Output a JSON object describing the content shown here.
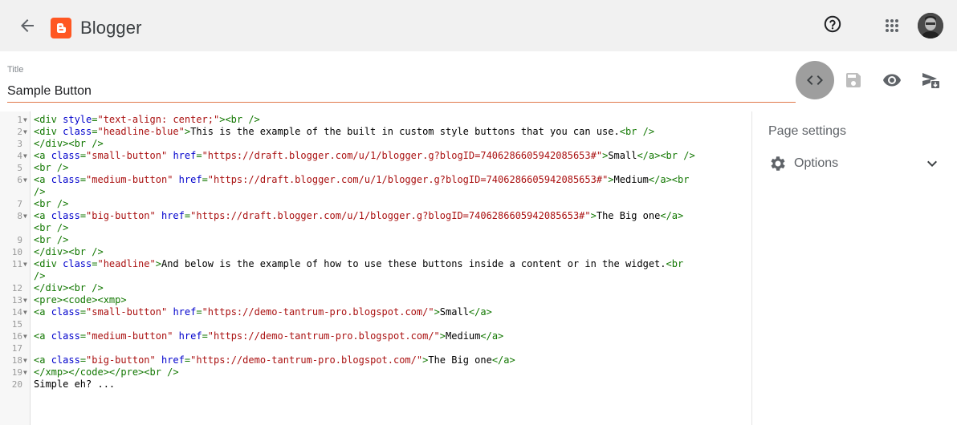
{
  "app": {
    "brand": "Blogger"
  },
  "icons": {
    "back": "arrow-back-icon",
    "logo": "blogger-logo-icon",
    "help": "help-icon",
    "apps": "apps-grid-icon",
    "avatar": "account-avatar",
    "html_view": "code-icon",
    "save": "save-icon",
    "preview": "eye-icon",
    "publish": "send-icon",
    "gear": "gear-icon",
    "chevron": "chevron-down-icon"
  },
  "colors": {
    "brand_orange": "#ff5722",
    "title_underline": "#e0794a",
    "html_view_bg": "#9e9e9e"
  },
  "title": {
    "label": "Title",
    "value": "Sample Button"
  },
  "sidebar": {
    "heading": "Page settings",
    "options_label": "Options"
  },
  "editor": {
    "lines": [
      {
        "n": "1",
        "fold": "▼",
        "y": 0,
        "parts": [
          [
            "t",
            "<div "
          ],
          [
            "a",
            "style"
          ],
          [
            "t",
            "="
          ],
          [
            "s",
            "\"text-align: center;\""
          ],
          [
            "t",
            ">"
          ],
          [
            "t",
            "<br />"
          ]
        ]
      },
      {
        "n": "2",
        "fold": "▼",
        "y": 1,
        "parts": [
          [
            "t",
            "<div "
          ],
          [
            "a",
            "class"
          ],
          [
            "t",
            "="
          ],
          [
            "s",
            "\"headline-blue\""
          ],
          [
            "t",
            ">"
          ],
          [
            "x",
            "This is the example of the built in custom style buttons that you can use."
          ],
          [
            "t",
            "<br />"
          ]
        ]
      },
      {
        "n": "3",
        "fold": "",
        "y": 2,
        "parts": [
          [
            "t",
            "</div><br />"
          ]
        ]
      },
      {
        "n": "4",
        "fold": "▼",
        "y": 3,
        "parts": [
          [
            "t",
            "<a "
          ],
          [
            "a",
            "class"
          ],
          [
            "t",
            "="
          ],
          [
            "s",
            "\"small-button\""
          ],
          [
            "x",
            " "
          ],
          [
            "a",
            "href"
          ],
          [
            "t",
            "="
          ],
          [
            "s",
            "\"https://draft.blogger.com/u/1/blogger.g?blogID=7406286605942085653#\""
          ],
          [
            "t",
            ">"
          ],
          [
            "x",
            "Small"
          ],
          [
            "t",
            "</a><br />"
          ]
        ]
      },
      {
        "n": "5",
        "fold": "",
        "y": 4,
        "parts": [
          [
            "t",
            "<br />"
          ]
        ]
      },
      {
        "n": "6",
        "fold": "▼",
        "y": 5,
        "parts": [
          [
            "t",
            "<a "
          ],
          [
            "a",
            "class"
          ],
          [
            "t",
            "="
          ],
          [
            "s",
            "\"medium-button\""
          ],
          [
            "x",
            " "
          ],
          [
            "a",
            "href"
          ],
          [
            "t",
            "="
          ],
          [
            "s",
            "\"https://draft.blogger.com/u/1/blogger.g?blogID=7406286605942085653#\""
          ],
          [
            "t",
            ">"
          ],
          [
            "x",
            "Medium"
          ],
          [
            "t",
            "</a><br"
          ]
        ]
      },
      {
        "n": "",
        "fold": "",
        "y": 6,
        "parts": [
          [
            "t",
            "/>"
          ]
        ]
      },
      {
        "n": "7",
        "fold": "",
        "y": 7,
        "parts": [
          [
            "t",
            "<br />"
          ]
        ]
      },
      {
        "n": "8",
        "fold": "▼",
        "y": 8,
        "parts": [
          [
            "t",
            "<a "
          ],
          [
            "a",
            "class"
          ],
          [
            "t",
            "="
          ],
          [
            "s",
            "\"big-button\""
          ],
          [
            "x",
            " "
          ],
          [
            "a",
            "href"
          ],
          [
            "t",
            "="
          ],
          [
            "s",
            "\"https://draft.blogger.com/u/1/blogger.g?blogID=7406286605942085653#\""
          ],
          [
            "t",
            ">"
          ],
          [
            "x",
            "The Big one"
          ],
          [
            "t",
            "</a>"
          ]
        ]
      },
      {
        "n": "",
        "fold": "",
        "y": 9,
        "parts": [
          [
            "t",
            "<br />"
          ]
        ]
      },
      {
        "n": "9",
        "fold": "",
        "y": 10,
        "parts": [
          [
            "t",
            "<br />"
          ]
        ]
      },
      {
        "n": "10",
        "fold": "",
        "y": 11,
        "parts": [
          [
            "t",
            "</div><br />"
          ]
        ]
      },
      {
        "n": "11",
        "fold": "▼",
        "y": 12,
        "parts": [
          [
            "t",
            "<div "
          ],
          [
            "a",
            "class"
          ],
          [
            "t",
            "="
          ],
          [
            "s",
            "\"headline\""
          ],
          [
            "t",
            ">"
          ],
          [
            "x",
            "And below is the example of how to use these buttons inside a content or in the widget."
          ],
          [
            "t",
            "<br"
          ]
        ]
      },
      {
        "n": "",
        "fold": "",
        "y": 13,
        "parts": [
          [
            "t",
            "/>"
          ]
        ]
      },
      {
        "n": "12",
        "fold": "",
        "y": 14,
        "parts": [
          [
            "t",
            "</div><br />"
          ]
        ]
      },
      {
        "n": "13",
        "fold": "▼",
        "y": 15,
        "parts": [
          [
            "t",
            "<pre><code><xmp>"
          ]
        ]
      },
      {
        "n": "14",
        "fold": "▼",
        "y": 16,
        "parts": [
          [
            "t",
            "<a "
          ],
          [
            "a",
            "class"
          ],
          [
            "t",
            "="
          ],
          [
            "s",
            "\"small-button\""
          ],
          [
            "x",
            " "
          ],
          [
            "a",
            "href"
          ],
          [
            "t",
            "="
          ],
          [
            "s",
            "\"https://demo-tantrum-pro.blogspot.com/\""
          ],
          [
            "t",
            ">"
          ],
          [
            "x",
            "Small"
          ],
          [
            "t",
            "</a>"
          ]
        ]
      },
      {
        "n": "15",
        "fold": "",
        "y": 17,
        "parts": []
      },
      {
        "n": "16",
        "fold": "▼",
        "y": 18,
        "parts": [
          [
            "t",
            "<a "
          ],
          [
            "a",
            "class"
          ],
          [
            "t",
            "="
          ],
          [
            "s",
            "\"medium-button\""
          ],
          [
            "x",
            " "
          ],
          [
            "a",
            "href"
          ],
          [
            "t",
            "="
          ],
          [
            "s",
            "\"https://demo-tantrum-pro.blogspot.com/\""
          ],
          [
            "t",
            ">"
          ],
          [
            "x",
            "Medium"
          ],
          [
            "t",
            "</a>"
          ]
        ]
      },
      {
        "n": "17",
        "fold": "",
        "y": 19,
        "parts": []
      },
      {
        "n": "18",
        "fold": "▼",
        "y": 20,
        "parts": [
          [
            "t",
            "<a "
          ],
          [
            "a",
            "class"
          ],
          [
            "t",
            "="
          ],
          [
            "s",
            "\"big-button\""
          ],
          [
            "x",
            " "
          ],
          [
            "a",
            "href"
          ],
          [
            "t",
            "="
          ],
          [
            "s",
            "\"https://demo-tantrum-pro.blogspot.com/\""
          ],
          [
            "t",
            ">"
          ],
          [
            "x",
            "The Big one"
          ],
          [
            "t",
            "</a>"
          ]
        ]
      },
      {
        "n": "19",
        "fold": "▼",
        "y": 21,
        "parts": [
          [
            "t",
            "</xmp></code></pre><br />"
          ]
        ]
      },
      {
        "n": "20",
        "fold": "",
        "y": 22,
        "parts": [
          [
            "x",
            "Simple eh? ..."
          ]
        ]
      }
    ]
  }
}
